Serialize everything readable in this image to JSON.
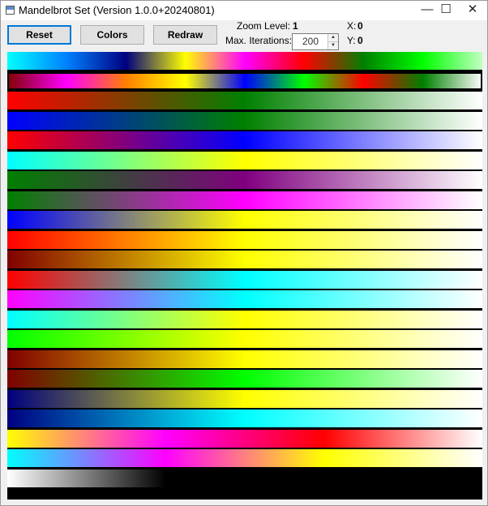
{
  "window": {
    "title": "Mandelbrot Set  (Version 1.0.0+20240801)",
    "controls": {
      "minimize": "—",
      "maximize": "☐",
      "close": "✕"
    }
  },
  "toolbar": {
    "reset_label": "Reset",
    "colors_label": "Colors",
    "redraw_label": "Redraw"
  },
  "info": {
    "zoom_label": "Zoom Level:",
    "zoom_value": "1",
    "iterations_label": "Max. Iterations:",
    "iterations_value": "200",
    "x_label": "X:",
    "x_value": "0",
    "y_label": "Y:",
    "y_value": "0"
  },
  "palettes": [
    {
      "stops": [
        "#00ffff",
        "#0080ff",
        "#000080",
        "#ffff00",
        "#ff00ff",
        "#ff0000",
        "#008000",
        "#00ff00",
        "#c0ffc0"
      ]
    },
    {
      "stops": [
        "#800000",
        "#ff00ff",
        "#ff8000",
        "#ffff00",
        "#0000ff",
        "#00ff00",
        "#ff0000",
        "#008000",
        "#ffffff"
      ],
      "selected": true
    },
    {
      "stops": [
        "#ff0000",
        "#008000",
        "#ffffff"
      ]
    },
    {
      "stops": [
        "#0000ff",
        "#008000",
        "#ffffff"
      ]
    },
    {
      "stops": [
        "#ff0000",
        "#0000ff",
        "#ffffff"
      ]
    },
    {
      "stops": [
        "#00ffff",
        "#ffff00",
        "#ffffff"
      ]
    },
    {
      "stops": [
        "#008000",
        "#800080",
        "#ffffff"
      ]
    },
    {
      "stops": [
        "#008000",
        "#ff00ff",
        "#ffffff"
      ]
    },
    {
      "stops": [
        "#0000ff",
        "#ffff00",
        "#ffffff"
      ]
    },
    {
      "stops": [
        "#ff0000",
        "#ffff00",
        "#ffffff"
      ]
    },
    {
      "stops": [
        "#800000",
        "#ffff00",
        "#ffffff"
      ]
    },
    {
      "stops": [
        "#ff0000",
        "#00ffff",
        "#ffffff"
      ]
    },
    {
      "stops": [
        "#ff00ff",
        "#00ffff",
        "#ffffff"
      ]
    },
    {
      "stops": [
        "#00ffff",
        "#ffff00",
        "#ffffff"
      ]
    },
    {
      "stops": [
        "#00ff00",
        "#ffff00",
        "#ffffff"
      ]
    },
    {
      "stops": [
        "#800000",
        "#ffff00",
        "#ffffff"
      ]
    },
    {
      "stops": [
        "#800000",
        "#00ff00",
        "#ffffff"
      ]
    },
    {
      "stops": [
        "#000080",
        "#ffff00",
        "#ffffff"
      ]
    },
    {
      "stops": [
        "#000080",
        "#00ffff",
        "#ffffff"
      ]
    },
    {
      "stops": [
        "#ffff00",
        "#ff00ff",
        "#ff0000",
        "#ffffff"
      ]
    },
    {
      "stops": [
        "#00ffff",
        "#ff00ff",
        "#ffff00",
        "#ffffff"
      ]
    },
    {
      "stops": [
        "#ffffff",
        "#000000",
        "#000000",
        "#000000"
      ]
    }
  ]
}
